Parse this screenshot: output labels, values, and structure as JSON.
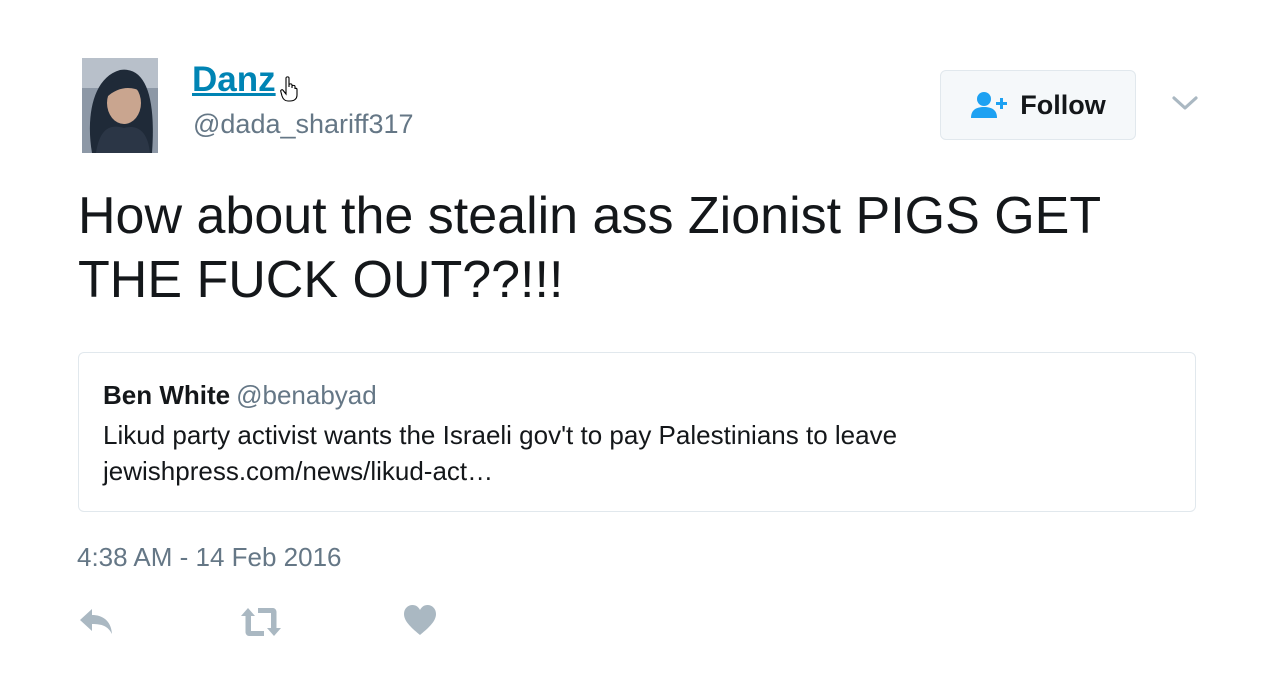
{
  "tweet": {
    "author": {
      "display_name": "Danz",
      "handle": "@dada_shariff317"
    },
    "follow_label": "Follow",
    "text": "How about the stealin ass Zionist PIGS GET THE FUCK OUT??!!!",
    "quoted_tweet": {
      "name": "Ben White",
      "handle": "@benabyad",
      "text": "Likud party activist wants the Israeli gov't to pay Palestinians to leave jewishpress.com/news/likud-act…"
    },
    "timestamp": "4:38 AM - 14 Feb 2016"
  },
  "icons": {
    "follow": "add-user-icon",
    "more": "chevron-down-icon",
    "reply": "reply-icon",
    "retweet": "retweet-icon",
    "like": "heart-icon"
  },
  "colors": {
    "link_blue": "#0084b4",
    "secondary_text": "#657786",
    "border": "#e1e8ed",
    "icon_gray": "#aab8c2",
    "follow_icon_blue": "#1da1f2"
  }
}
